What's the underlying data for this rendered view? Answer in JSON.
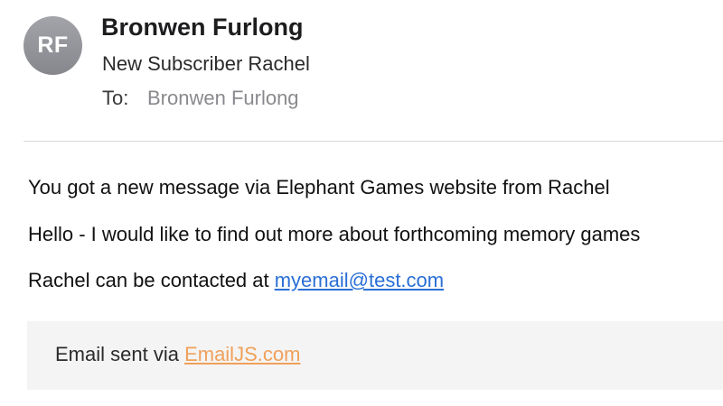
{
  "header": {
    "avatar_initials": "RF",
    "sender_name": "Bronwen Furlong",
    "subject": "New Subscriber Rachel",
    "to_label": "To:",
    "to_value": "Bronwen Furlong"
  },
  "body": {
    "line1": "You got a new message via Elephant Games website from Rachel",
    "line2": "Hello - I would like to find out more about forthcoming memory games",
    "line3_prefix": "Rachel can be contacted at ",
    "line3_link": "myemail@test.com"
  },
  "footer": {
    "prefix": "Email sent via ",
    "link": "EmailJS.com"
  },
  "colors": {
    "link_blue": "#2a6fd6",
    "footer_link_orange": "#f0a05a",
    "footer_background": "#f4f4f4",
    "avatar_gray": "#95969c"
  }
}
